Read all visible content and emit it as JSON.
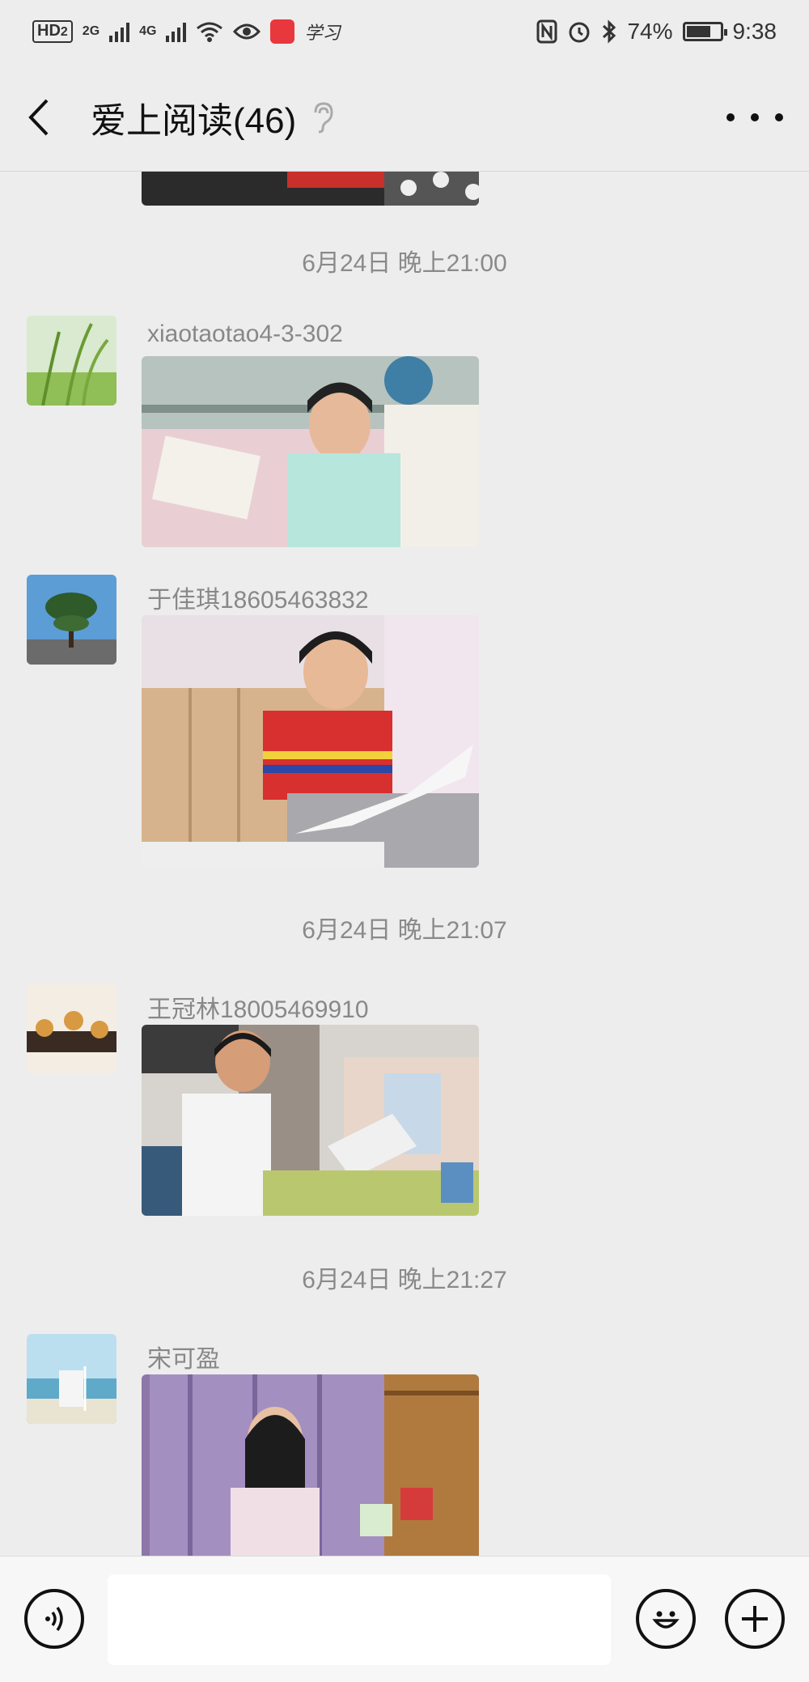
{
  "status_bar": {
    "hd_label": "HD",
    "hd_sub": "2",
    "net1": "2G",
    "net2": "4G",
    "app_label": "学习",
    "battery_pct": "74%",
    "battery_level": 0.74,
    "time": "9:38"
  },
  "header": {
    "title": "爱上阅读(46)"
  },
  "messages": [
    {
      "timestamp": "6月24日 晚上21:00"
    },
    {
      "sender": "xiaotaotao4-3-302"
    },
    {
      "sender": "于佳琪18605463832"
    },
    {
      "timestamp": "6月24日 晚上21:07"
    },
    {
      "sender": "王冠林18005469910"
    },
    {
      "timestamp": "6月24日 晚上21:27"
    },
    {
      "sender": "宋可盈"
    }
  ],
  "input": {
    "value": "",
    "placeholder": ""
  },
  "icons": {
    "back": "chevron-left-icon",
    "ear": "ear-icon",
    "more": "more-icon",
    "voice": "voice-icon",
    "emoji": "emoji-icon",
    "plus": "plus-icon"
  },
  "colors": {
    "background": "#ededed",
    "input_bar": "#f7f7f7",
    "text_muted": "#8a8a8a"
  }
}
